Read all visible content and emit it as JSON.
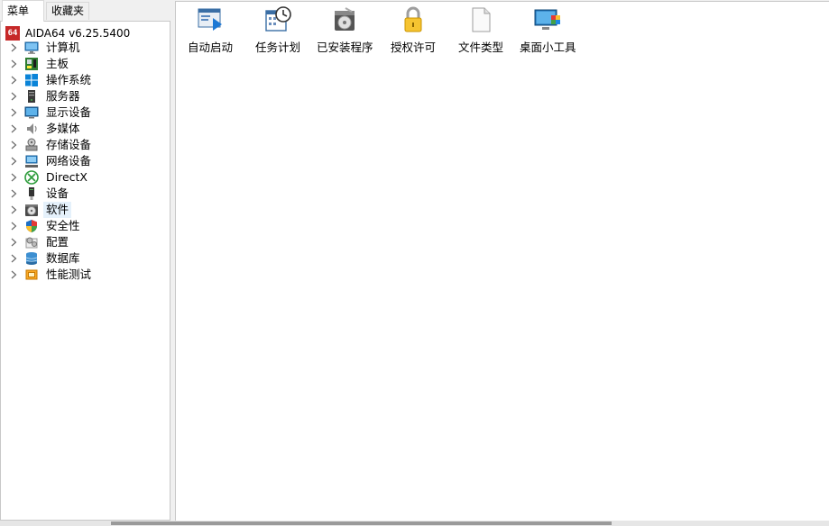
{
  "tabs": {
    "menu": "菜单",
    "favorites": "收藏夹"
  },
  "tree": {
    "root": {
      "logo_text": "64",
      "label": "AIDA64 v6.25.5400"
    },
    "items": [
      {
        "label": "计算机",
        "icon": "computer-icon"
      },
      {
        "label": "主板",
        "icon": "motherboard-icon"
      },
      {
        "label": "操作系统",
        "icon": "windows-icon"
      },
      {
        "label": "服务器",
        "icon": "server-icon"
      },
      {
        "label": "显示设备",
        "icon": "monitor-icon"
      },
      {
        "label": "多媒体",
        "icon": "speaker-icon"
      },
      {
        "label": "存储设备",
        "icon": "storage-icon"
      },
      {
        "label": "网络设备",
        "icon": "network-icon"
      },
      {
        "label": "DirectX",
        "icon": "xbox-icon"
      },
      {
        "label": "设备",
        "icon": "device-icon"
      },
      {
        "label": "软件",
        "icon": "software-icon",
        "selected": true
      },
      {
        "label": "安全性",
        "icon": "shield-icon"
      },
      {
        "label": "配置",
        "icon": "config-icon"
      },
      {
        "label": "数据库",
        "icon": "database-icon"
      },
      {
        "label": "性能测试",
        "icon": "benchmark-icon"
      }
    ]
  },
  "content": {
    "icons": [
      {
        "label": "自动启动",
        "icon": "autostart-icon"
      },
      {
        "label": "任务计划",
        "icon": "scheduled-tasks-icon"
      },
      {
        "label": "已安装程序",
        "icon": "installed-programs-icon"
      },
      {
        "label": "授权许可",
        "icon": "license-lock-icon"
      },
      {
        "label": "文件类型",
        "icon": "file-type-icon"
      },
      {
        "label": "桌面小工具",
        "icon": "desktop-gadgets-icon"
      }
    ]
  },
  "colors": {
    "accent": "#0078d7",
    "selected_bg": "#e5f1fb",
    "logo_red": "#c62828"
  }
}
